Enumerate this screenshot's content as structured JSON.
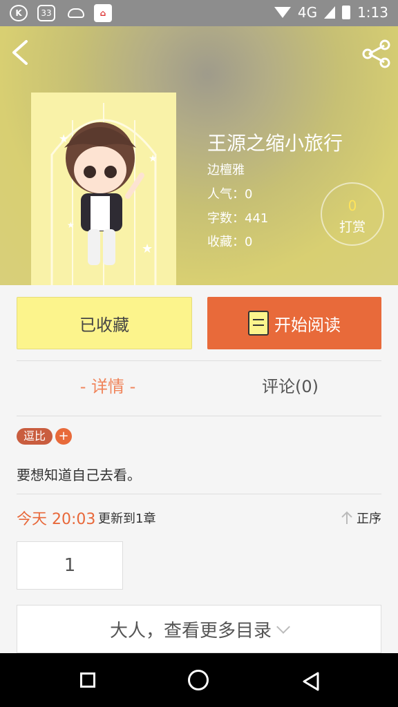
{
  "status_bar": {
    "notification_count": "33",
    "network": "4G",
    "time": "1:13",
    "app_icon_letter": "K"
  },
  "book": {
    "title": "王源之缩小旅行",
    "author": "边檀雅",
    "popularity": "人气：0",
    "word_count": "字数：441",
    "favorites": "收藏：0",
    "tip_count": "0",
    "tip_label": "打赏"
  },
  "actions": {
    "favorite_label": "已收藏",
    "read_label": "开始阅读"
  },
  "tabs": {
    "detail_label": "- 详情 -",
    "comment_label": "评论(0)"
  },
  "tags": {
    "items": [
      "逗比"
    ],
    "add_label": "+"
  },
  "description": "要想知道自己去看。",
  "update": {
    "time_label": "今天 20:03",
    "note": "更新到1章",
    "order_label": "正序"
  },
  "chapters": {
    "items": [
      "1"
    ],
    "more_label": "大人，查看更多目录"
  },
  "colors": {
    "accent": "#e86a3a",
    "favorite_bg": "#fcf48c",
    "header_bg": "#d8cf72"
  },
  "icons": [
    "back-icon",
    "share-icon",
    "book-icon",
    "arrow-up-icon",
    "chevron-down-icon"
  ]
}
